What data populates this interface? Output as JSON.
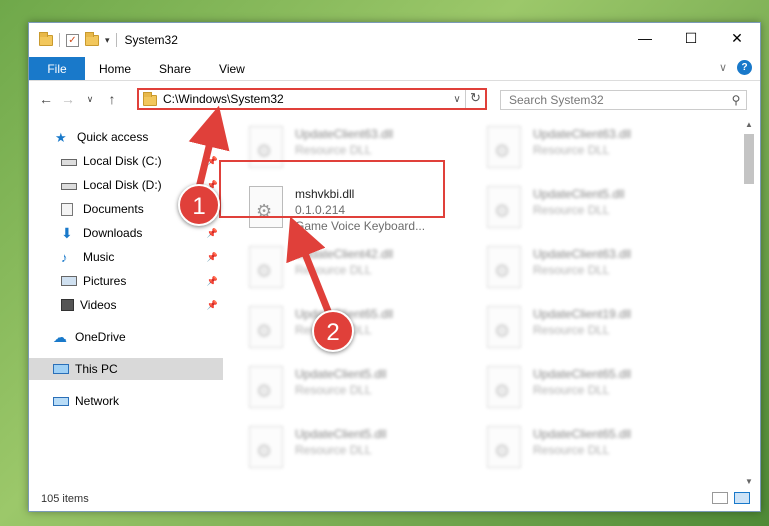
{
  "window": {
    "title": "System32",
    "minimize": "—",
    "maximize": "☐",
    "close": "✕"
  },
  "ribbon": {
    "file": "File",
    "tabs": [
      "Home",
      "Share",
      "View"
    ],
    "expand": "∨",
    "help": "?"
  },
  "nav": {
    "back": "←",
    "forward": "→",
    "recent": "∨",
    "up": "↑"
  },
  "address": {
    "path": "C:\\Windows\\System32",
    "dropdown": "∨",
    "refresh": "↻"
  },
  "search": {
    "placeholder": "Search System32",
    "icon": "⚲"
  },
  "sidebar": {
    "items": [
      {
        "label": "Quick access",
        "icon": "star-icon",
        "pinned": false
      },
      {
        "label": "Local Disk (C:)",
        "icon": "drive-icon",
        "pinned": true
      },
      {
        "label": "Local Disk (D:)",
        "icon": "drive-icon",
        "pinned": true
      },
      {
        "label": "Documents",
        "icon": "documents-icon",
        "pinned": true
      },
      {
        "label": "Downloads",
        "icon": "download-icon",
        "pinned": true
      },
      {
        "label": "Music",
        "icon": "music-icon",
        "pinned": true
      },
      {
        "label": "Pictures",
        "icon": "pictures-icon",
        "pinned": true
      },
      {
        "label": "Videos",
        "icon": "videos-icon",
        "pinned": true
      },
      {
        "label": "OneDrive",
        "icon": "cloud-icon",
        "pinned": false
      },
      {
        "label": "This PC",
        "icon": "computer-icon",
        "pinned": false,
        "selected": true
      },
      {
        "label": "Network",
        "icon": "network-icon",
        "pinned": false
      }
    ]
  },
  "files": {
    "highlighted": {
      "name": "mshvkbi.dll",
      "version": "0.1.0.214",
      "desc": "Game Voice Keyboard..."
    },
    "left": [
      {
        "name": "UpdateClient63.dll",
        "desc": "Resource DLL"
      },
      {
        "name": "UpdateClient42.dll",
        "desc": "Resource DLL"
      },
      {
        "name": "UpdateClient65.dll",
        "desc": "Resource DLL"
      },
      {
        "name": "UpdateClient5.dll",
        "desc": "Resource DLL"
      },
      {
        "name": "UpdateClient5.dll",
        "desc": "Resource DLL"
      }
    ],
    "right": [
      {
        "name": "UpdateClient63.dll",
        "desc": "Resource DLL"
      },
      {
        "name": "UpdateClient5.dll",
        "desc": "Resource DLL"
      },
      {
        "name": "UpdateClient63.dll",
        "desc": "Resource DLL"
      },
      {
        "name": "UpdateClient19.dll",
        "desc": "Resource DLL"
      },
      {
        "name": "UpdateClient65.dll",
        "desc": "Resource DLL"
      },
      {
        "name": "UpdateClient65.dll",
        "desc": "Resource DLL"
      }
    ]
  },
  "status": {
    "count": "105 items"
  },
  "annotations": {
    "step1": "1",
    "step2": "2",
    "color": "#e0403a"
  }
}
